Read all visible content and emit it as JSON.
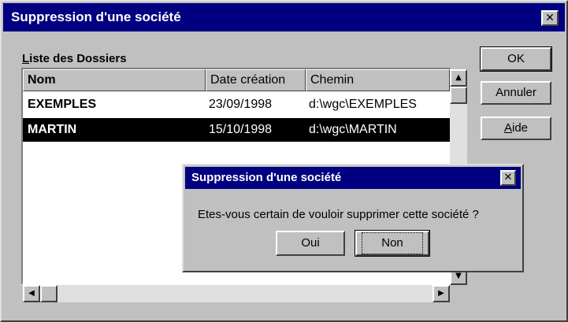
{
  "window": {
    "title": "Suppression d'une société",
    "close_glyph": "✕"
  },
  "list": {
    "label_prefix": "L",
    "label_rest": "iste des Dossiers",
    "columns": [
      "Nom",
      "Date création",
      "Chemin"
    ],
    "rows": [
      {
        "nom": "EXEMPLES",
        "date": "23/09/1998",
        "chemin": "d:\\wgc\\EXEMPLES",
        "selected": false
      },
      {
        "nom": "MARTIN",
        "date": "15/10/1998",
        "chemin": "d:\\wgc\\MARTIN",
        "selected": true
      }
    ]
  },
  "buttons": {
    "ok": "OK",
    "annuler": "Annuler",
    "aide_prefix": "A",
    "aide_rest": "ide"
  },
  "scroll": {
    "up": "▲",
    "down": "▼",
    "left": "◀",
    "right": "▶"
  },
  "confirm": {
    "title": "Suppression d'une société",
    "close_glyph": "✕",
    "message": "Etes-vous certain de vouloir supprimer cette société ?",
    "yes": "Oui",
    "no": "Non"
  },
  "colors": {
    "titlebar": "#000080",
    "face": "#c0c0c0",
    "selection": "#000000"
  }
}
